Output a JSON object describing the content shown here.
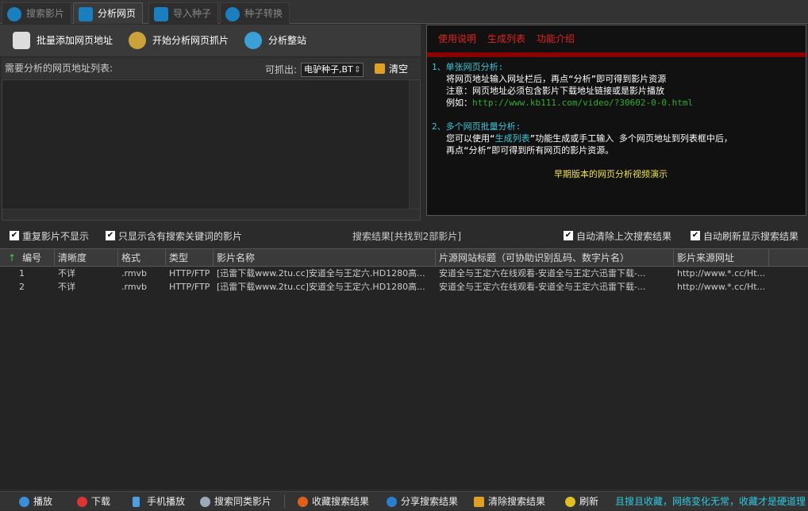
{
  "tabs": [
    {
      "label": "搜索影片"
    },
    {
      "label": "分析网页"
    },
    {
      "label": "导入种子"
    },
    {
      "label": "种子转换"
    }
  ],
  "toolbar": {
    "batch_add": "批量添加网页地址",
    "start_analyze": "开始分析网页抓片",
    "analyze_site": "分析整站"
  },
  "list": {
    "label": "需要分析的网页地址列表:",
    "capture_label": "可抓出:",
    "capture_value": "电驴种子,BT",
    "clear": "清空"
  },
  "help": {
    "links": [
      "使用说明",
      "生成列表",
      "功能介绍"
    ],
    "s1_title": "1、单张网页分析:",
    "s1_l1": "将网页地址输入网址栏后，再点“分析”即可得到影片资源",
    "s1_l2": "注意：网页地址必须包含影片下载地址链接或是影片播放",
    "s1_l3_prefix": "例如：",
    "s1_l3_url": "http://www.kb111.com/video/?30602-0-0.html",
    "s2_title": "2、多个网页批量分析:",
    "s2_l1_a": "您可以使用“",
    "s2_l1_link": "生成列表",
    "s2_l1_b": "”功能生成或手工输入 多个网页地址到列表框中后，",
    "s2_l2": "再点“分析”即可得到所有网页的影片资源。",
    "video": "早期版本的网页分析视频演示"
  },
  "options": {
    "no_dup": "重复影片不显示",
    "only_kw": "只显示含有搜索关键词的影片",
    "status": "搜索结果[共找到2部影片]",
    "auto_clear": "自动清除上次搜索结果",
    "auto_refresh": "自动刷新显示搜索结果"
  },
  "table": {
    "headers": [
      "编号",
      "清晰度",
      "格式",
      "类型",
      "影片名称",
      "片源网站标题（可协助识别乱码、数字片名）",
      "影片来源网址"
    ],
    "rows": [
      [
        "1",
        "不详",
        ".rmvb",
        "HTTP/FTP",
        "[迅雷下载www.2tu.cc]安道全与王定六.HD1280高...",
        "安道全与王定六在线观看-安道全与王定六迅雷下载-...",
        "http://www.*.cc/Ht..."
      ],
      [
        "2",
        "不详",
        ".rmvb",
        "HTTP/FTP",
        "[迅雷下载www.2tu.cc]安道全与王定六.HD1280高...",
        "安道全与王定六在线观看-安道全与王定六迅雷下载-...",
        "http://www.*.cc/Ht..."
      ]
    ]
  },
  "bottom": {
    "play": "播放",
    "download": "下载",
    "mobile": "手机播放",
    "search_similar": "搜索同类影片",
    "favorite": "收藏搜索结果",
    "share": "分享搜索结果",
    "clear": "清除搜索结果",
    "refresh": "刷新",
    "slogan": "且搜且收藏，网络变化无常，收藏才是硬道理"
  }
}
